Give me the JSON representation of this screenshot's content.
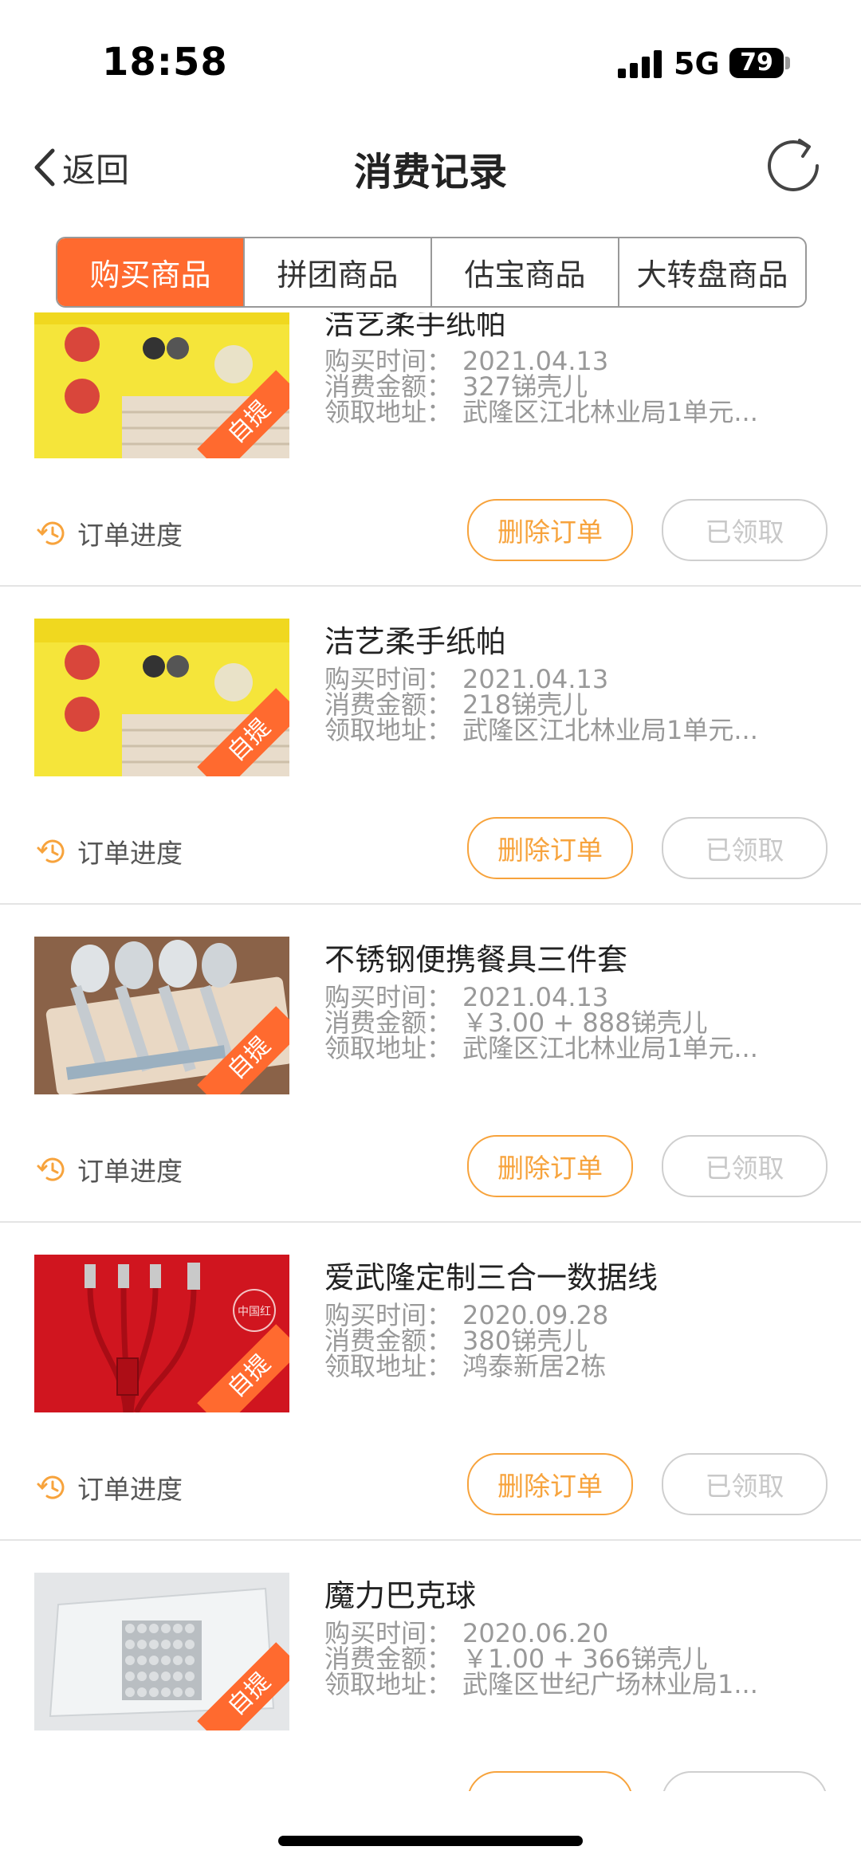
{
  "status_bar": {
    "time": "18:58",
    "network": "5G",
    "battery": "79"
  },
  "nav": {
    "back_label": "返回",
    "title": "消费记录"
  },
  "tabs": [
    {
      "label": "购买商品",
      "active": true
    },
    {
      "label": "拼团商品",
      "active": false
    },
    {
      "label": "估宝商品",
      "active": false
    },
    {
      "label": "大转盘商品",
      "active": false
    }
  ],
  "labels": {
    "purchase_time": "购买时间：",
    "amount": "消费金额：",
    "address": "领取地址：",
    "progress": "订单进度",
    "delete": "删除订单",
    "claimed": "已领取",
    "pickup_badge": "自提"
  },
  "orders": [
    {
      "title": "洁艺柔手纸帕",
      "time": "2021.04.13",
      "amount": "327锑壳儿",
      "address": "武隆区江北林业局1单元...",
      "image": "tissue-pack-image"
    },
    {
      "title": "洁艺柔手纸帕",
      "time": "2021.04.13",
      "amount": "218锑壳儿",
      "address": "武隆区江北林业局1单元...",
      "image": "tissue-pack-image"
    },
    {
      "title": "不锈钢便携餐具三件套",
      "time": "2021.04.13",
      "amount": "￥3.00 + 888锑壳儿",
      "address": "武隆区江北林业局1单元...",
      "image": "cutlery-set-image"
    },
    {
      "title": "爱武隆定制三合一数据线",
      "time": "2020.09.28",
      "amount": "380锑壳儿",
      "address": "鸿泰新居2栋",
      "image": "data-cable-image",
      "image_text": "中国红"
    },
    {
      "title": "魔力巴克球",
      "time": "2020.06.20",
      "amount": "￥1.00 + 366锑壳儿",
      "address": "武隆区世纪广场林业局1...",
      "image": "magnetic-balls-image"
    }
  ],
  "colors": {
    "accent": "#ff6a2f",
    "button_orange": "#f7a33c",
    "muted": "#999999"
  }
}
